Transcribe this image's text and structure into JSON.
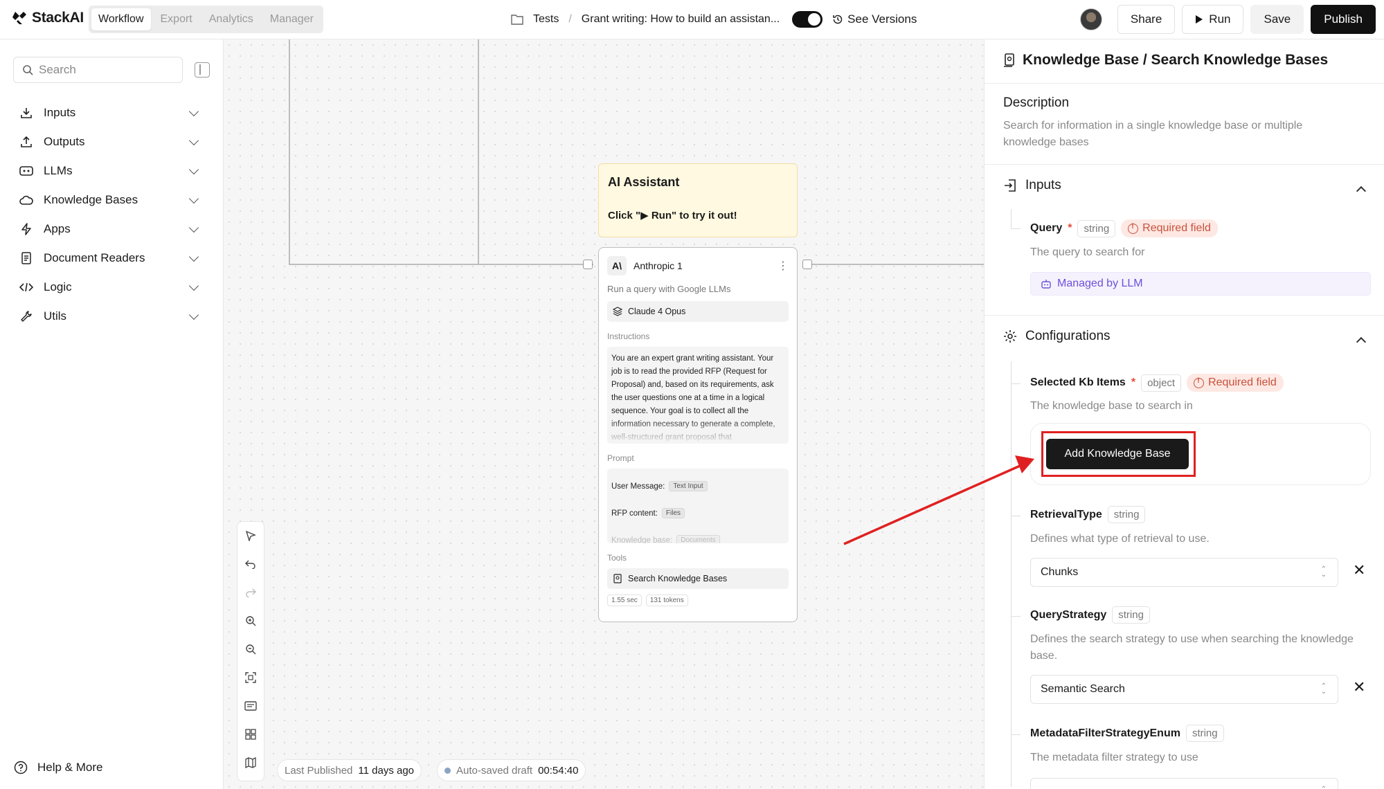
{
  "app": {
    "name": "StackAI",
    "tabs": [
      "Workflow",
      "Export",
      "Analytics",
      "Manager"
    ],
    "active_tab": "Workflow"
  },
  "breadcrumb": {
    "folder": "Tests",
    "project": "Grant writing: How to build an assistan..."
  },
  "header": {
    "see_versions": "See Versions",
    "share": "Share",
    "run": "Run",
    "save": "Save",
    "publish": "Publish"
  },
  "sidebar": {
    "search_placeholder": "Search",
    "items": [
      {
        "label": "Inputs",
        "icon": "download-icon"
      },
      {
        "label": "Outputs",
        "icon": "upload-icon"
      },
      {
        "label": "LLMs",
        "icon": "llm-icon"
      },
      {
        "label": "Knowledge Bases",
        "icon": "cloud-icon"
      },
      {
        "label": "Apps",
        "icon": "bolt-icon"
      },
      {
        "label": "Document Readers",
        "icon": "document-icon"
      },
      {
        "label": "Logic",
        "icon": "code-icon"
      },
      {
        "label": "Utils",
        "icon": "wrench-icon"
      }
    ],
    "help": "Help & More"
  },
  "canvas": {
    "note": {
      "title": "AI Assistant",
      "text": "Click \"▶ Run\" to try it out!"
    },
    "node": {
      "title": "Anthropic 1",
      "subtitle": "Run a query with Google LLMs",
      "model": "Claude 4 Opus",
      "instructions_label": "Instructions",
      "instructions": "You are an expert grant writing assistant. Your job is to read the provided RFP (Request for Proposal) and, based on its requirements, ask the user questions one at a time in a logical sequence. Your goal is to collect all the information necessary to generate a complete, well-structured grant proposal that",
      "prompt_label": "Prompt",
      "prompt_lines": [
        {
          "label": "User Message:",
          "chip": "Text Input"
        },
        {
          "label": "RFP content:",
          "chip": "Files"
        },
        {
          "label": "Knowledge base:",
          "chip": "Documents"
        }
      ],
      "tools_label": "Tools",
      "tool": "Search Knowledge Bases",
      "time": "1.55 sec",
      "tokens": "131 tokens"
    },
    "status": {
      "last_published_label": "Last Published",
      "last_published_value": "11 days ago",
      "autosave_label": "Auto-saved draft",
      "autosave_value": "00:54:40"
    }
  },
  "panel": {
    "title": "Knowledge Base / Search Knowledge Bases",
    "description_heading": "Description",
    "description": "Search for information in a single knowledge base or multiple knowledge bases",
    "inputs_heading": "Inputs",
    "query": {
      "name": "Query",
      "type": "string",
      "required": "Required field",
      "desc": "The query to search for",
      "managed": "Managed by LLM"
    },
    "config_heading": "Configurations",
    "kb_items": {
      "name": "Selected Kb Items",
      "type": "object",
      "required": "Required field",
      "desc": "The knowledge base to search in",
      "button": "Add Knowledge Base"
    },
    "retrieval": {
      "name": "RetrievalType",
      "type": "string",
      "desc": "Defines what type of retrieval to use.",
      "value": "Chunks"
    },
    "query_strategy": {
      "name": "QueryStrategy",
      "type": "string",
      "desc": "Defines the search strategy to use when searching the knowledge base.",
      "value": "Semantic Search"
    },
    "metadata": {
      "name": "MetadataFilterStrategyEnum",
      "type": "string",
      "desc": "The metadata filter strategy to use"
    }
  },
  "colors": {
    "accent_llm": "#6d4fd8",
    "required": "#c9503b",
    "annotation": "#e02020"
  }
}
